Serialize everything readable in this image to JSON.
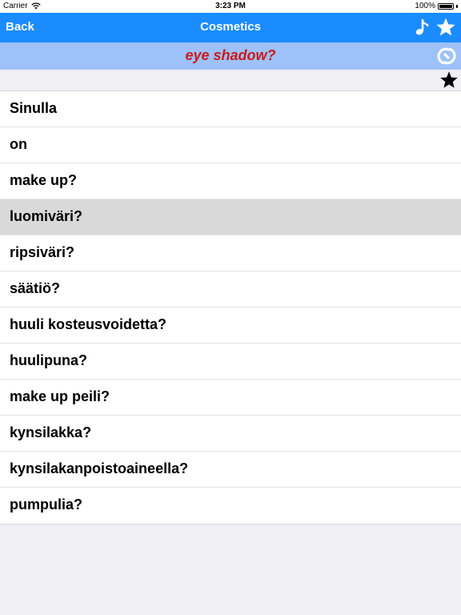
{
  "status_bar": {
    "carrier": "Carrier",
    "time": "3:23 PM",
    "battery_text": "100%",
    "battery_level": 1.0
  },
  "nav": {
    "back_label": "Back",
    "title": "Cosmetics",
    "music_icon": "music-note-icon",
    "star_icon": "star-icon",
    "bg_color": "#1a8cff"
  },
  "phrase": {
    "text": "eye shadow?",
    "color": "#cc1a1a",
    "bg_color": "#9dc1f8",
    "icon": "refresh-icon"
  },
  "favorite": {
    "icon": "star-icon"
  },
  "list": {
    "selected_index": 3,
    "items": [
      "Sinulla",
      "on",
      "make up?",
      "luomiväri?",
      "ripsiväri?",
      "säätiö?",
      "huuli kosteusvoidetta?",
      "huulipuna?",
      "make up peili?",
      "kynsilakka?",
      "kynsilakanpoistoaineella?",
      "pumpulia?"
    ]
  }
}
